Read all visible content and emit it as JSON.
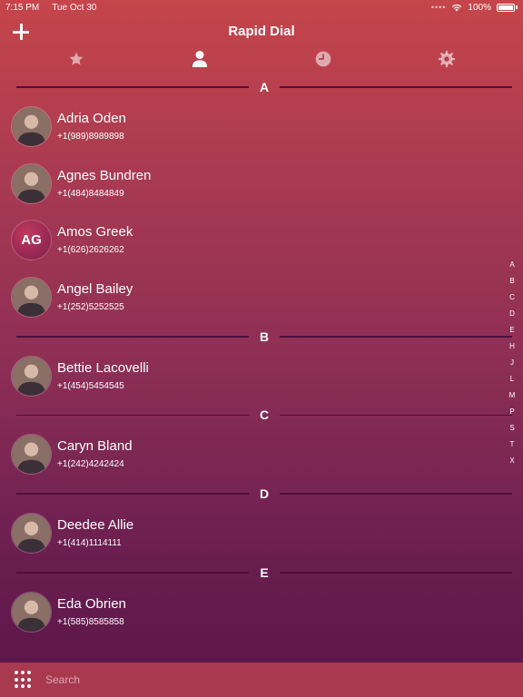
{
  "status_bar": {
    "time": "7:15 PM",
    "date": "Tue Oct 30",
    "battery": "100%"
  },
  "nav": {
    "title": "Rapid Dial",
    "add_icon": "plus-icon"
  },
  "tabs": [
    {
      "icon": "star-icon"
    },
    {
      "icon": "person-icon",
      "selected": true
    },
    {
      "icon": "clock-icon"
    },
    {
      "icon": "gear-icon"
    }
  ],
  "sections": [
    {
      "letter": "A",
      "contacts": [
        {
          "name": "Adria Oden",
          "phone": "+1(989)8989898",
          "avatar": "photo"
        },
        {
          "name": "Agnes Bundren",
          "phone": "+1(484)8484849",
          "avatar": "photo"
        },
        {
          "name": "Amos Greek",
          "phone": "+1(626)2626262",
          "avatar": "initials",
          "initials": "AG"
        },
        {
          "name": "Angel Bailey",
          "phone": "+1(252)5252525",
          "avatar": "photo"
        }
      ]
    },
    {
      "letter": "B",
      "contacts": [
        {
          "name": "Bettie Lacovelli",
          "phone": "+1(454)5454545",
          "avatar": "photo"
        }
      ]
    },
    {
      "letter": "C",
      "contacts": [
        {
          "name": "Caryn Bland",
          "phone": "+1(242)4242424",
          "avatar": "photo"
        }
      ]
    },
    {
      "letter": "D",
      "contacts": [
        {
          "name": "Deedee Allie",
          "phone": "+1(414)1114111",
          "avatar": "photo"
        }
      ]
    },
    {
      "letter": "E",
      "contacts": [
        {
          "name": "Eda Obrien",
          "phone": "+1(585)8585858",
          "avatar": "photo"
        }
      ]
    }
  ],
  "index_letters": [
    "A",
    "B",
    "C",
    "D",
    "E",
    "H",
    "J",
    "L",
    "M",
    "P",
    "S",
    "T",
    "X"
  ],
  "search": {
    "placeholder": "Search"
  },
  "colors": {
    "accent": "#c6454a",
    "bottom_bar": "#a8394f",
    "divider": "#4e0e3c"
  }
}
